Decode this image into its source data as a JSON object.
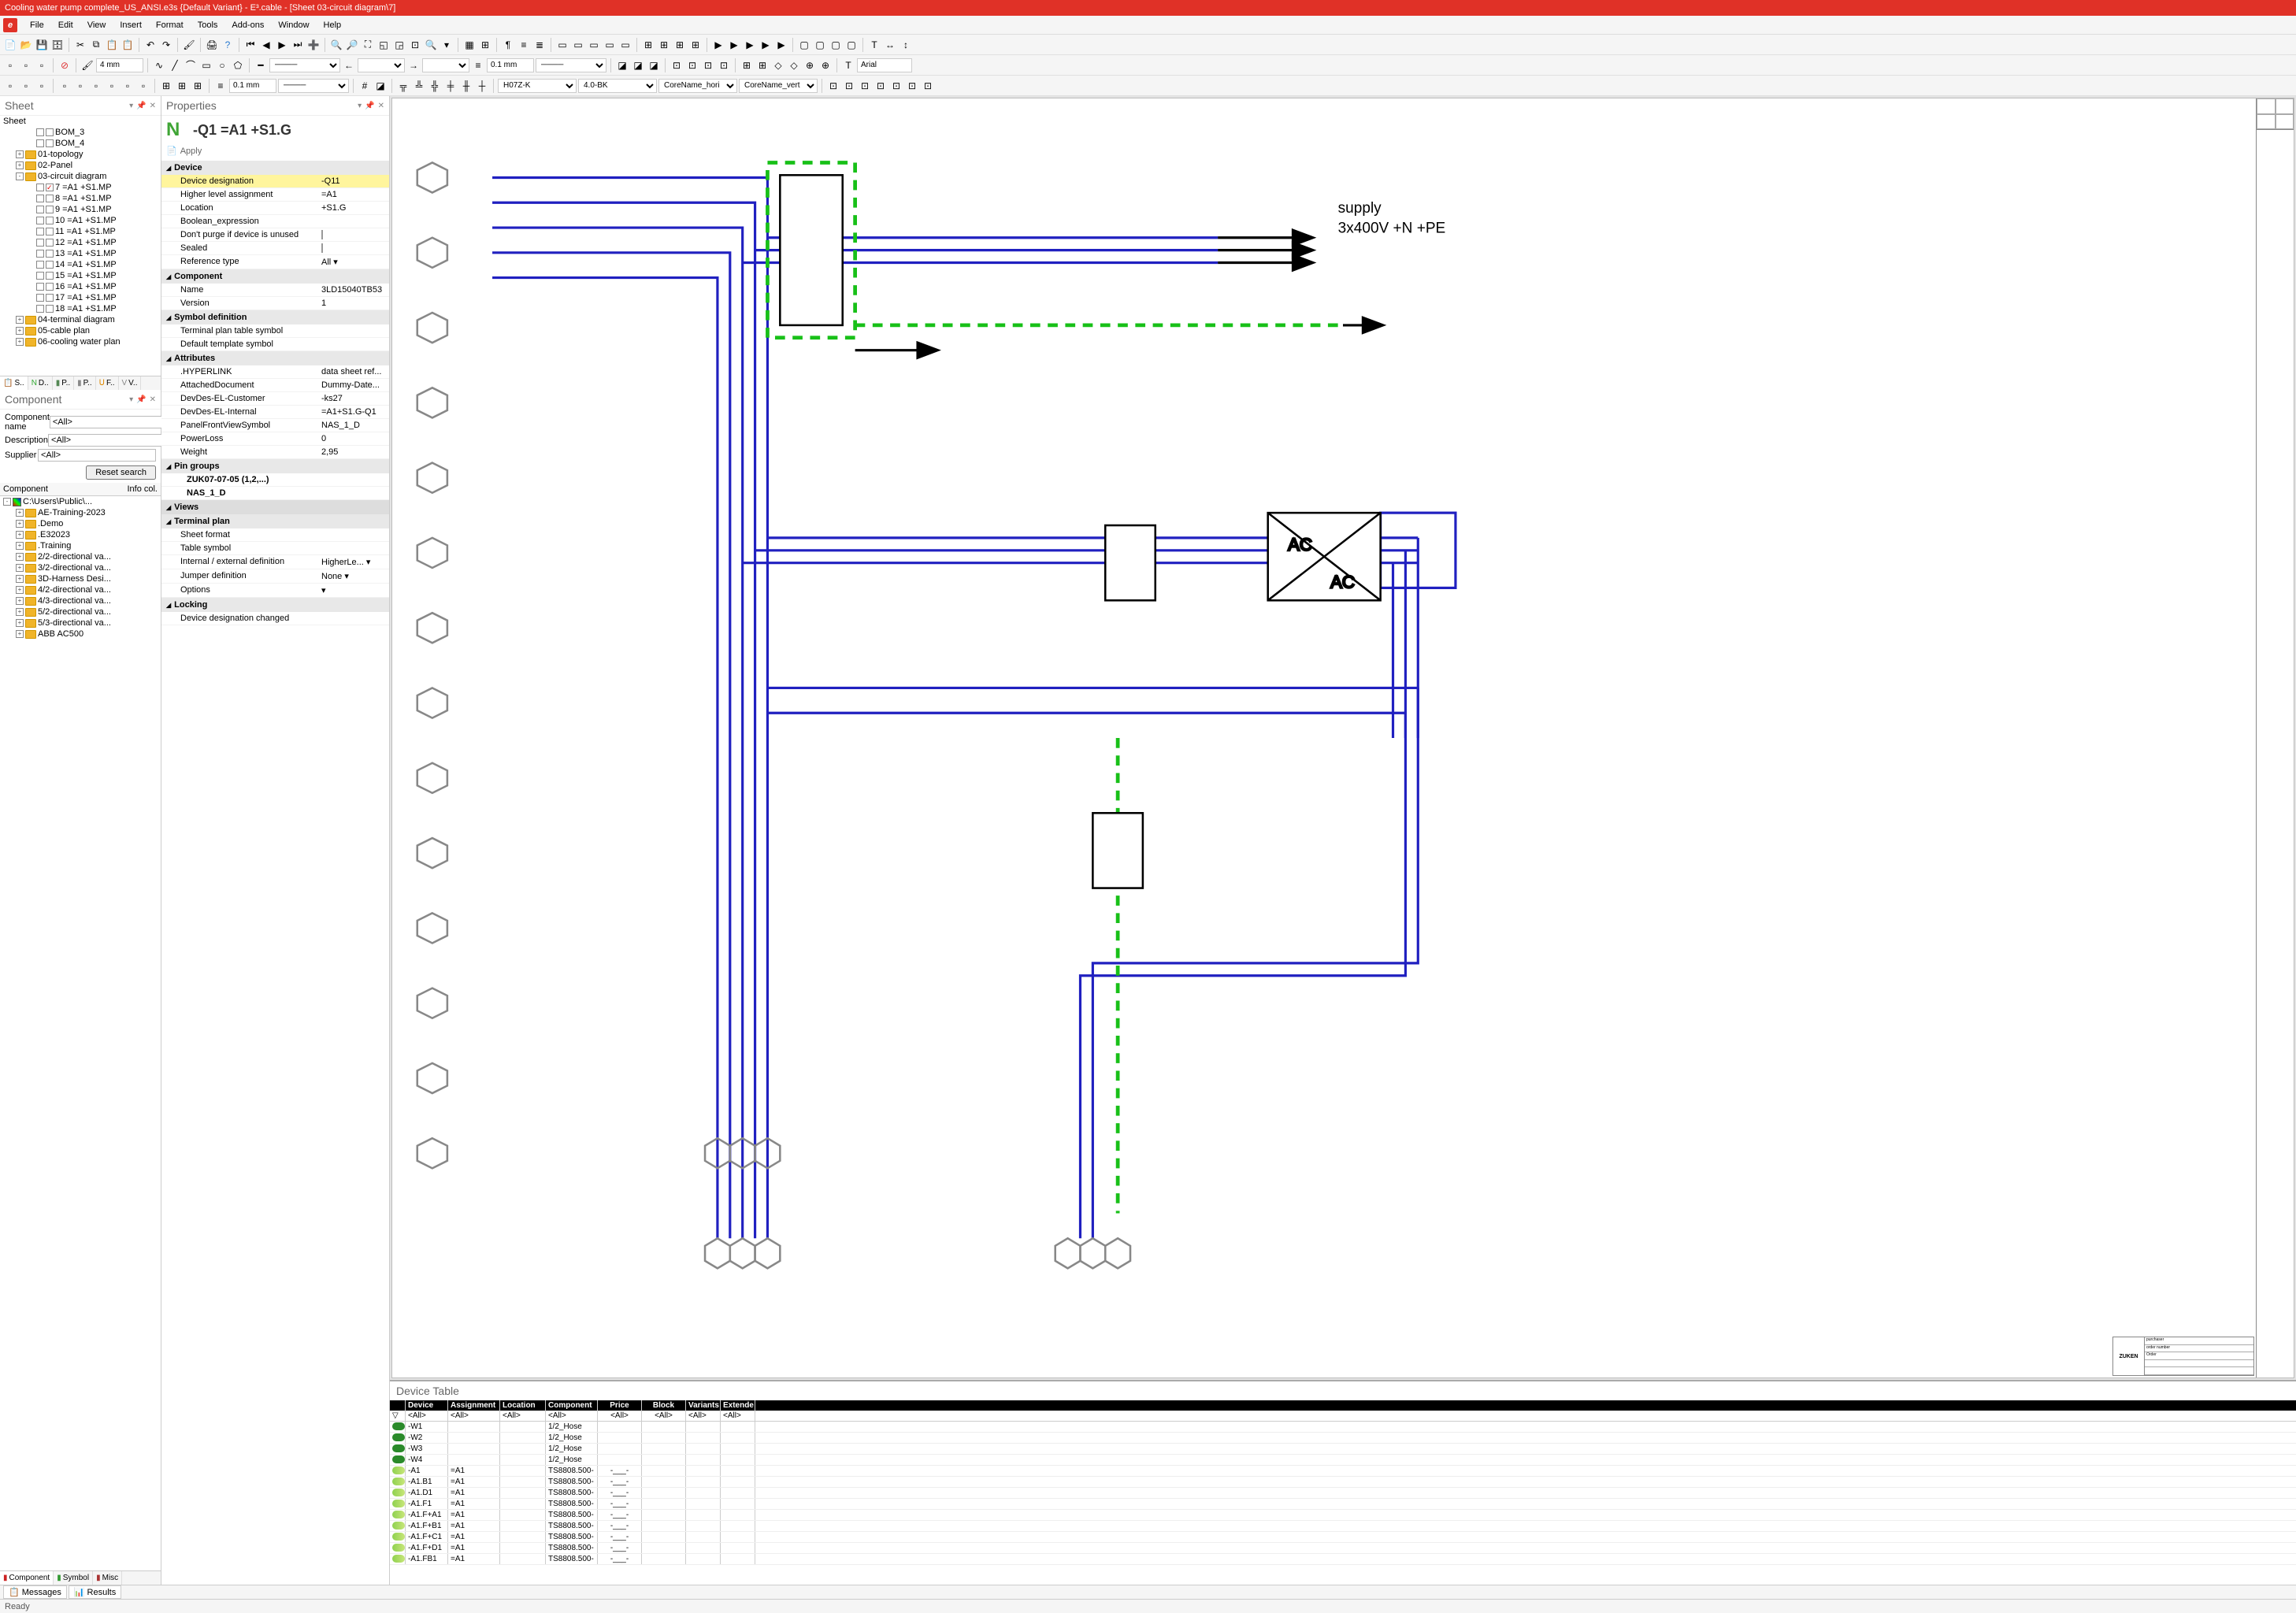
{
  "title": "Cooling water pump complete_US_ANSI.e3s {Default Variant} - E³.cable - [Sheet 03-circuit diagram\\7]",
  "menu": [
    "File",
    "Edit",
    "View",
    "Insert",
    "Format",
    "Tools",
    "Add-ons",
    "Window",
    "Help"
  ],
  "toolbar2": {
    "measure1": "4 mm",
    "measure2": "0.1 mm",
    "font": "Arial"
  },
  "toolbar3": {
    "measure": "0.1 mm",
    "dd1": "H07Z-K",
    "dd2": "4.0-BK",
    "dd3": "CoreName_hori",
    "dd4": "CoreName_vert"
  },
  "sheet": {
    "panel_title": "Sheet",
    "root": "Sheet",
    "nodes": [
      {
        "indent": 2,
        "chk": false,
        "label": "BOM_3"
      },
      {
        "indent": 2,
        "chk": false,
        "label": "BOM_4"
      },
      {
        "indent": 1,
        "exp": "+",
        "folder": true,
        "label": "01-topology"
      },
      {
        "indent": 1,
        "exp": "+",
        "folder": true,
        "label": "02-Panel"
      },
      {
        "indent": 1,
        "exp": "-",
        "folder": true,
        "label": "03-circuit diagram"
      },
      {
        "indent": 2,
        "chk": true,
        "label": "7 =A1 +S1.MP"
      },
      {
        "indent": 2,
        "chk": false,
        "label": "8 =A1 +S1.MP"
      },
      {
        "indent": 2,
        "chk": false,
        "label": "9 =A1 +S1.MP"
      },
      {
        "indent": 2,
        "chk": false,
        "label": "10 =A1 +S1.MP"
      },
      {
        "indent": 2,
        "chk": false,
        "label": "11 =A1 +S1.MP"
      },
      {
        "indent": 2,
        "chk": false,
        "label": "12 =A1 +S1.MP"
      },
      {
        "indent": 2,
        "chk": false,
        "label": "13 =A1 +S1.MP"
      },
      {
        "indent": 2,
        "chk": false,
        "label": "14 =A1 +S1.MP"
      },
      {
        "indent": 2,
        "chk": false,
        "label": "15 =A1 +S1.MP"
      },
      {
        "indent": 2,
        "chk": false,
        "label": "16 =A1 +S1.MP"
      },
      {
        "indent": 2,
        "chk": false,
        "label": "17 =A1 +S1.MP"
      },
      {
        "indent": 2,
        "chk": false,
        "label": "18 =A1 +S1.MP"
      },
      {
        "indent": 1,
        "exp": "+",
        "folder": true,
        "label": "04-terminal diagram"
      },
      {
        "indent": 1,
        "exp": "+",
        "folder": true,
        "label": "05-cable plan"
      },
      {
        "indent": 1,
        "exp": "+",
        "folder": true,
        "label": "06-cooling water plan"
      }
    ],
    "tabs": [
      "S..",
      "D..",
      "P..",
      "P..",
      "F..",
      "V.."
    ]
  },
  "component": {
    "panel_title": "Component",
    "filters": {
      "name_label": "Component name",
      "name_val": "<All>",
      "desc_label": "Description",
      "desc_val": "<All>",
      "supp_label": "Supplier",
      "supp_val": "<All>",
      "reset": "Reset search"
    },
    "list_header": {
      "c1": "Component",
      "c2": "Info col."
    },
    "root": "C:\\Users\\Public\\...",
    "items": [
      "AE-Training-2023",
      ".Demo",
      ".E32023",
      ".Training",
      "2/2-directional va...",
      "3/2-directional va...",
      "3D-Harness Desi...",
      "4/2-directional va...",
      "4/3-directional va...",
      "5/2-directional va...",
      "5/3-directional va...",
      "ABB AC500"
    ],
    "bottom_tabs": [
      "Component",
      "Symbol",
      "Misc"
    ]
  },
  "properties": {
    "panel_title": "Properties",
    "heading": "-Q1 =A1 +S1.G",
    "apply": "Apply",
    "groups": [
      {
        "name": "Device",
        "rows": [
          {
            "k": "Device designation",
            "v": "-Q11",
            "sel": true
          },
          {
            "k": "Higher level assignment",
            "v": "=A1"
          },
          {
            "k": "Location",
            "v": "+S1.G"
          },
          {
            "k": "Boolean_expression",
            "v": ""
          },
          {
            "k": "Don't purge if device is unused",
            "v": "[chk]"
          },
          {
            "k": "Sealed",
            "v": "[chk]"
          },
          {
            "k": "Reference type",
            "v": "All",
            "dd": true
          }
        ]
      },
      {
        "name": "Component",
        "rows": [
          {
            "k": "Name",
            "v": "3LD15040TB53"
          },
          {
            "k": "Version",
            "v": "1"
          }
        ]
      },
      {
        "name": "Symbol definition",
        "rows": [
          {
            "k": "Terminal plan table symbol",
            "v": ""
          },
          {
            "k": "Default template symbol",
            "v": ""
          }
        ]
      },
      {
        "name": "Attributes",
        "rows": [
          {
            "k": ".HYPERLINK",
            "v": "data sheet ref..."
          },
          {
            "k": "AttachedDocument",
            "v": "Dummy-Date..."
          },
          {
            "k": "DevDes-EL-Customer",
            "v": "-ks27"
          },
          {
            "k": "DevDes-EL-Internal",
            "v": "=A1+S1.G-Q1"
          },
          {
            "k": "PanelFrontViewSymbol",
            "v": "NAS_1_D"
          },
          {
            "k": "PowerLoss",
            "v": "0"
          },
          {
            "k": "Weight",
            "v": "2,95"
          }
        ]
      },
      {
        "name": "Pin groups",
        "rows": [
          {
            "k": "ZUK07-07-05 (1,2,...)",
            "sub": true
          },
          {
            "k": "NAS_1_D",
            "sub": true
          }
        ]
      },
      {
        "name": "Views",
        "rows": [],
        "grey": true
      },
      {
        "name": "Terminal plan",
        "rows": [
          {
            "k": "Sheet format",
            "v": ""
          },
          {
            "k": "Table symbol",
            "v": ""
          },
          {
            "k": "Internal / external definition",
            "v": "HigherLe...",
            "dd": true
          },
          {
            "k": "Jumper definition",
            "v": "None",
            "dd": true
          },
          {
            "k": "Options",
            "v": "",
            "dd": true
          }
        ]
      },
      {
        "name": "Locking",
        "rows": [
          {
            "k": "Device designation changed",
            "v": ""
          }
        ]
      }
    ]
  },
  "canvas": {
    "supply_label": "supply\n3x400V +N +PE",
    "zuken": "ZUKEN",
    "frame_text": [
      "purchaser",
      "order number",
      "Order"
    ]
  },
  "device_table": {
    "title": "Device Table",
    "headers": [
      "Device",
      "Assignment",
      "Location",
      "Component",
      "Price",
      "Block",
      "Variants",
      "Extende"
    ],
    "filter": "<All>",
    "rows": [
      {
        "ico": "green",
        "dev": "-W1",
        "ass": "",
        "loc": "",
        "comp": "1/2_Hose",
        "price": "",
        "block": "",
        "var": "",
        "ext": ""
      },
      {
        "ico": "green",
        "dev": "-W2",
        "ass": "",
        "loc": "",
        "comp": "1/2_Hose",
        "price": "",
        "block": "",
        "var": "",
        "ext": ""
      },
      {
        "ico": "green",
        "dev": "-W3",
        "ass": "",
        "loc": "",
        "comp": "1/2_Hose",
        "price": "",
        "block": "",
        "var": "",
        "ext": ""
      },
      {
        "ico": "green",
        "dev": "-W4",
        "ass": "",
        "loc": "",
        "comp": "1/2_Hose",
        "price": "",
        "block": "",
        "var": "",
        "ext": ""
      },
      {
        "ico": "lime",
        "dev": "-A1",
        "ass": "=A1",
        "loc": "",
        "comp": "TS8808.500-",
        "price": "-___-",
        "block": "",
        "var": "",
        "ext": ""
      },
      {
        "ico": "lime",
        "dev": "-A1.B1",
        "ass": "=A1",
        "loc": "",
        "comp": "TS8808.500-",
        "price": "-___-",
        "block": "",
        "var": "",
        "ext": ""
      },
      {
        "ico": "lime",
        "dev": "-A1.D1",
        "ass": "=A1",
        "loc": "",
        "comp": "TS8808.500-",
        "price": "-___-",
        "block": "",
        "var": "",
        "ext": ""
      },
      {
        "ico": "lime",
        "dev": "-A1.F1",
        "ass": "=A1",
        "loc": "",
        "comp": "TS8808.500-",
        "price": "-___-",
        "block": "",
        "var": "",
        "ext": ""
      },
      {
        "ico": "lime",
        "dev": "-A1.F+A1",
        "ass": "=A1",
        "loc": "",
        "comp": "TS8808.500-",
        "price": "-___-",
        "block": "",
        "var": "",
        "ext": ""
      },
      {
        "ico": "lime",
        "dev": "-A1.F+B1",
        "ass": "=A1",
        "loc": "",
        "comp": "TS8808.500-",
        "price": "-___-",
        "block": "",
        "var": "",
        "ext": ""
      },
      {
        "ico": "lime",
        "dev": "-A1.F+C1",
        "ass": "=A1",
        "loc": "",
        "comp": "TS8808.500-",
        "price": "-___-",
        "block": "",
        "var": "",
        "ext": ""
      },
      {
        "ico": "lime",
        "dev": "-A1.F+D1",
        "ass": "=A1",
        "loc": "",
        "comp": "TS8808.500-",
        "price": "-___-",
        "block": "",
        "var": "",
        "ext": ""
      },
      {
        "ico": "lime",
        "dev": "-A1.FB1",
        "ass": "=A1",
        "loc": "",
        "comp": "TS8808.500-",
        "price": "-___-",
        "block": "",
        "var": "",
        "ext": ""
      }
    ]
  },
  "status": {
    "tabs": [
      "Messages",
      "Results"
    ],
    "text": "Ready"
  }
}
